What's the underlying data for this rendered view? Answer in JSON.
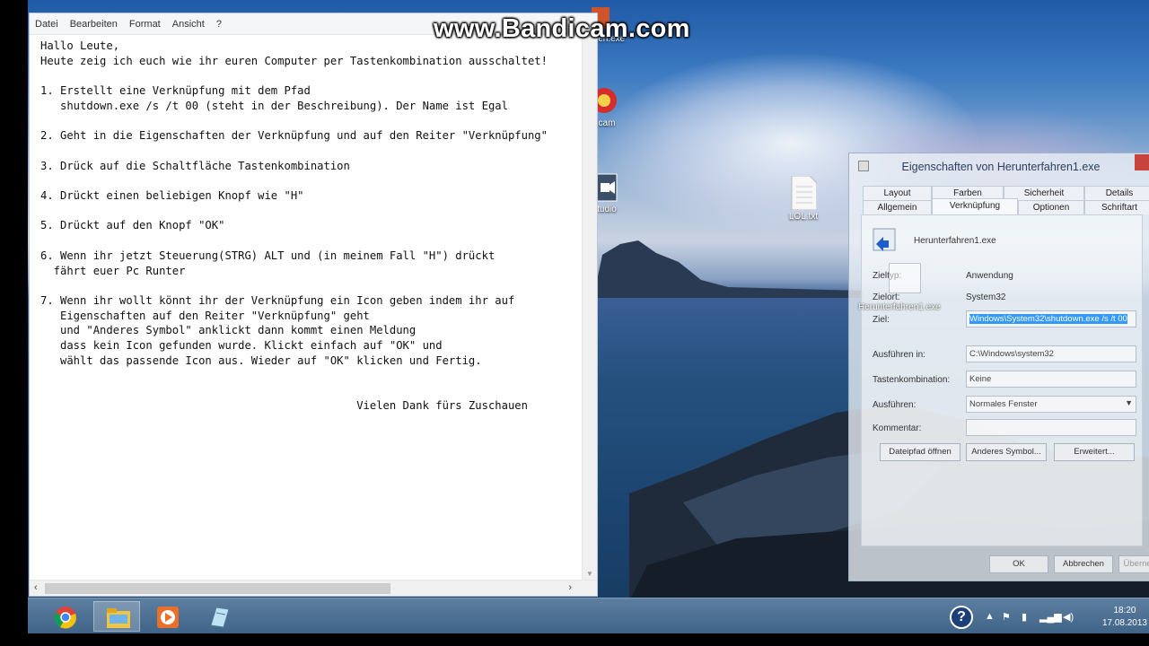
{
  "watermark": "www.Bandicam.com",
  "notepad": {
    "menu": [
      "Datei",
      "Bearbeiten",
      "Format",
      "Ansicht",
      "?"
    ],
    "text": "Hallo Leute,\nHeute zeig ich euch wie ihr euren Computer per Tastenkombination ausschaltet!\n\n1. Erstellt eine Verknüpfung mit dem Pfad\n   shutdown.exe /s /t 00 (steht in der Beschreibung). Der Name ist Egal\n\n2. Geht in die Eigenschaften der Verknüpfung und auf den Reiter \"Verknüpfung\"\n\n3. Drück auf die Schaltfläche Tastenkombination\n\n4. Drückt einen beliebigen Knopf wie \"H\"\n\n5. Drückt auf den Knopf \"OK\"\n\n6. Wenn ihr jetzt Steuerung(STRG) ALT und (in meinem Fall \"H\") drückt\n  fährt euer Pc Runter\n\n7. Wenn ihr wollt könnt ihr der Verknüpfung ein Icon geben indem ihr auf\n   Eigenschaften auf den Reiter \"Verknüpfung\" geht\n   und \"Anderes Symbol\" anklickt dann kommt einen Meldung\n   dass kein Icon gefunden wurde. Klickt einfach auf \"OK\" und\n   wählt das passende Icon aus. Wieder auf \"OK\" klicken und Fertig.\n\n\n                                                Vielen Dank fürs Zuschauen"
  },
  "desktop_icons": {
    "top_label": "ahren.exe",
    "cam_label": "cam",
    "studio_label": "tudio",
    "lol_label": "LOL.txt"
  },
  "dialog": {
    "title": "Eigenschaften von Herunterfahren1.exe",
    "tabs_row1": [
      "Layout",
      "Farben",
      "Sicherheit",
      "Details"
    ],
    "tabs_row2": [
      "Allgemein",
      "Verknüpfung",
      "Optionen",
      "Schriftart"
    ],
    "file_name": "Herunterfahren1.exe",
    "labels": {
      "zieltyp": "Zieltyp:",
      "zielort": "Zielort:",
      "ziel": "Ziel:",
      "ausfuehren_in": "Ausführen in:",
      "tastenkombination": "Tastenkombination:",
      "ausfuehren": "Ausführen:",
      "kommentar": "Kommentar:"
    },
    "values": {
      "zieltyp": "Anwendung",
      "zielort": "System32",
      "ziel": "Windows\\System32\\shutdown.exe /s /t 00",
      "ausfuehren_in": "C:\\Windows\\system32",
      "tastenkombination": "Keine",
      "ausfuehren": "Normales Fenster",
      "kommentar": ""
    },
    "ghost_label": "Herunterfahren1.exe",
    "buttons": {
      "dateipfad": "Dateipfad öffnen",
      "anderes_symbol": "Anderes Symbol...",
      "erweitert": "Erweitert...",
      "ok": "OK",
      "abbrechen": "Abbrechen",
      "uebernehmen": "Übernehmen"
    }
  },
  "tray": {
    "time": "18:20",
    "date": "17.08.2013"
  },
  "colors": {
    "taskbar": "#4a6e92",
    "selection": "#3399ff",
    "close": "#c7443e"
  }
}
